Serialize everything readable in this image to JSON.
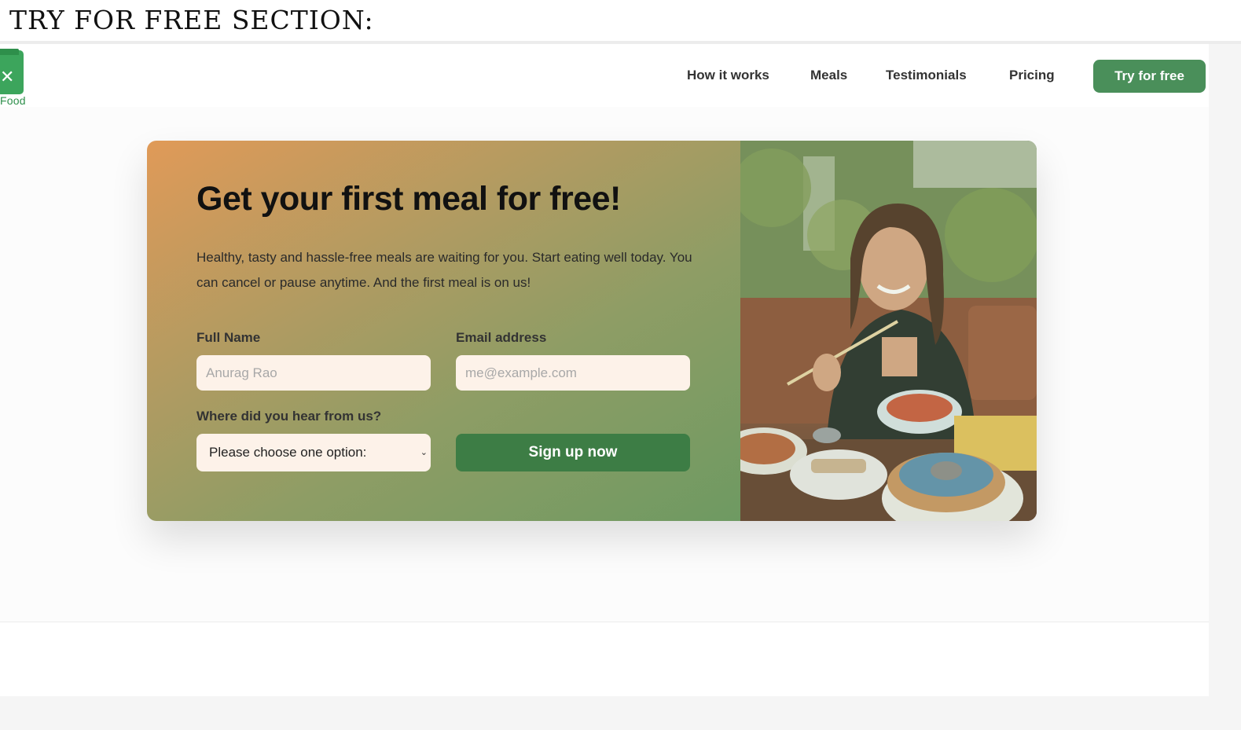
{
  "caption": "TRY FOR FREE SECTION:",
  "header": {
    "logo_text": "Food",
    "nav": [
      {
        "label": "How it works"
      },
      {
        "label": "Meals"
      },
      {
        "label": "Testimonials"
      },
      {
        "label": "Pricing"
      }
    ],
    "cta_label": "Try for free"
  },
  "cta": {
    "title": "Get your first meal for free!",
    "text": "Healthy, tasty and hassle-free meals are waiting for you. Start eating well today. You can cancel or pause anytime. And the first meal is on us!",
    "form": {
      "full_name_label": "Full Name",
      "full_name_placeholder": "Anurag Rao",
      "email_label": "Email address",
      "email_placeholder": "me@example.com",
      "source_label": "Where did you hear from us?",
      "source_selected": "Please choose one option:",
      "submit_label": "Sign up now"
    }
  },
  "colors": {
    "brand_green": "#4a8f5a",
    "button_green": "#3d7d45",
    "gradient_start": "#e09a58",
    "gradient_end": "#6e9a62",
    "input_bg": "#fdf2e9"
  },
  "icons": [
    "utensils-icon",
    "chevron-down-icon"
  ]
}
